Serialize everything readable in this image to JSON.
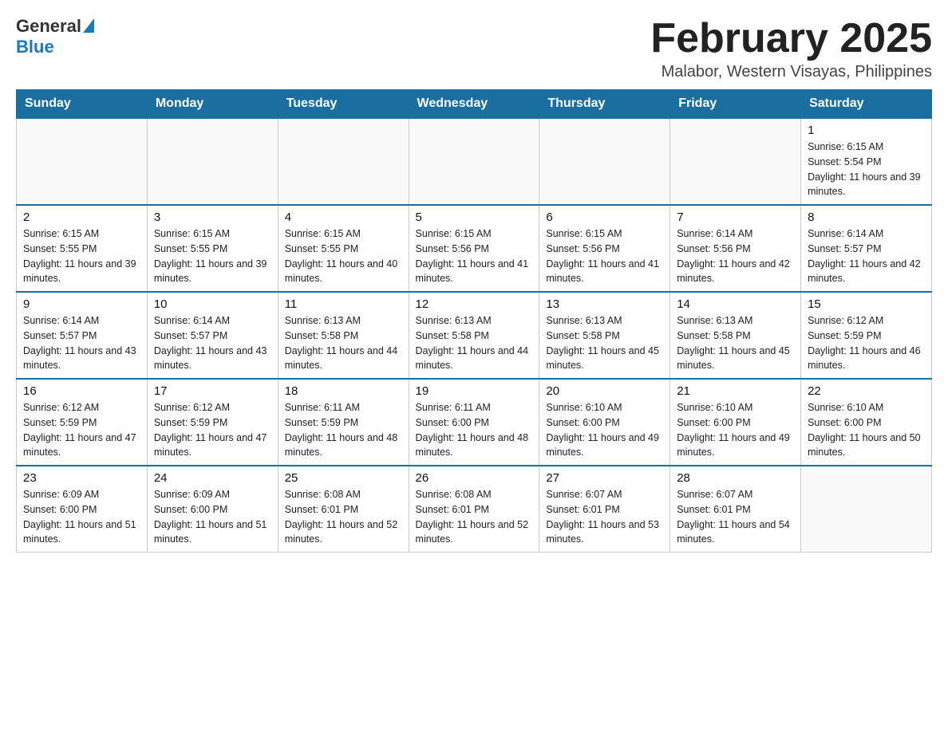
{
  "header": {
    "logo_general": "General",
    "logo_blue": "Blue",
    "month_title": "February 2025",
    "location": "Malabor, Western Visayas, Philippines"
  },
  "days_of_week": [
    "Sunday",
    "Monday",
    "Tuesday",
    "Wednesday",
    "Thursday",
    "Friday",
    "Saturday"
  ],
  "weeks": [
    [
      {
        "day": "",
        "info": ""
      },
      {
        "day": "",
        "info": ""
      },
      {
        "day": "",
        "info": ""
      },
      {
        "day": "",
        "info": ""
      },
      {
        "day": "",
        "info": ""
      },
      {
        "day": "",
        "info": ""
      },
      {
        "day": "1",
        "info": "Sunrise: 6:15 AM\nSunset: 5:54 PM\nDaylight: 11 hours and 39 minutes."
      }
    ],
    [
      {
        "day": "2",
        "info": "Sunrise: 6:15 AM\nSunset: 5:55 PM\nDaylight: 11 hours and 39 minutes."
      },
      {
        "day": "3",
        "info": "Sunrise: 6:15 AM\nSunset: 5:55 PM\nDaylight: 11 hours and 39 minutes."
      },
      {
        "day": "4",
        "info": "Sunrise: 6:15 AM\nSunset: 5:55 PM\nDaylight: 11 hours and 40 minutes."
      },
      {
        "day": "5",
        "info": "Sunrise: 6:15 AM\nSunset: 5:56 PM\nDaylight: 11 hours and 41 minutes."
      },
      {
        "day": "6",
        "info": "Sunrise: 6:15 AM\nSunset: 5:56 PM\nDaylight: 11 hours and 41 minutes."
      },
      {
        "day": "7",
        "info": "Sunrise: 6:14 AM\nSunset: 5:56 PM\nDaylight: 11 hours and 42 minutes."
      },
      {
        "day": "8",
        "info": "Sunrise: 6:14 AM\nSunset: 5:57 PM\nDaylight: 11 hours and 42 minutes."
      }
    ],
    [
      {
        "day": "9",
        "info": "Sunrise: 6:14 AM\nSunset: 5:57 PM\nDaylight: 11 hours and 43 minutes."
      },
      {
        "day": "10",
        "info": "Sunrise: 6:14 AM\nSunset: 5:57 PM\nDaylight: 11 hours and 43 minutes."
      },
      {
        "day": "11",
        "info": "Sunrise: 6:13 AM\nSunset: 5:58 PM\nDaylight: 11 hours and 44 minutes."
      },
      {
        "day": "12",
        "info": "Sunrise: 6:13 AM\nSunset: 5:58 PM\nDaylight: 11 hours and 44 minutes."
      },
      {
        "day": "13",
        "info": "Sunrise: 6:13 AM\nSunset: 5:58 PM\nDaylight: 11 hours and 45 minutes."
      },
      {
        "day": "14",
        "info": "Sunrise: 6:13 AM\nSunset: 5:58 PM\nDaylight: 11 hours and 45 minutes."
      },
      {
        "day": "15",
        "info": "Sunrise: 6:12 AM\nSunset: 5:59 PM\nDaylight: 11 hours and 46 minutes."
      }
    ],
    [
      {
        "day": "16",
        "info": "Sunrise: 6:12 AM\nSunset: 5:59 PM\nDaylight: 11 hours and 47 minutes."
      },
      {
        "day": "17",
        "info": "Sunrise: 6:12 AM\nSunset: 5:59 PM\nDaylight: 11 hours and 47 minutes."
      },
      {
        "day": "18",
        "info": "Sunrise: 6:11 AM\nSunset: 5:59 PM\nDaylight: 11 hours and 48 minutes."
      },
      {
        "day": "19",
        "info": "Sunrise: 6:11 AM\nSunset: 6:00 PM\nDaylight: 11 hours and 48 minutes."
      },
      {
        "day": "20",
        "info": "Sunrise: 6:10 AM\nSunset: 6:00 PM\nDaylight: 11 hours and 49 minutes."
      },
      {
        "day": "21",
        "info": "Sunrise: 6:10 AM\nSunset: 6:00 PM\nDaylight: 11 hours and 49 minutes."
      },
      {
        "day": "22",
        "info": "Sunrise: 6:10 AM\nSunset: 6:00 PM\nDaylight: 11 hours and 50 minutes."
      }
    ],
    [
      {
        "day": "23",
        "info": "Sunrise: 6:09 AM\nSunset: 6:00 PM\nDaylight: 11 hours and 51 minutes."
      },
      {
        "day": "24",
        "info": "Sunrise: 6:09 AM\nSunset: 6:00 PM\nDaylight: 11 hours and 51 minutes."
      },
      {
        "day": "25",
        "info": "Sunrise: 6:08 AM\nSunset: 6:01 PM\nDaylight: 11 hours and 52 minutes."
      },
      {
        "day": "26",
        "info": "Sunrise: 6:08 AM\nSunset: 6:01 PM\nDaylight: 11 hours and 52 minutes."
      },
      {
        "day": "27",
        "info": "Sunrise: 6:07 AM\nSunset: 6:01 PM\nDaylight: 11 hours and 53 minutes."
      },
      {
        "day": "28",
        "info": "Sunrise: 6:07 AM\nSunset: 6:01 PM\nDaylight: 11 hours and 54 minutes."
      },
      {
        "day": "",
        "info": ""
      }
    ]
  ]
}
